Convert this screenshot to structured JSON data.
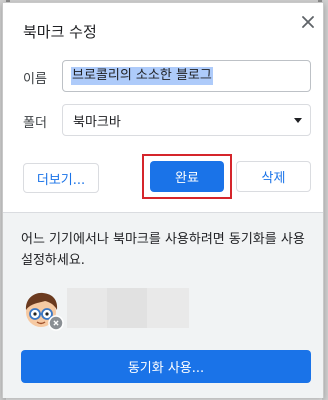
{
  "dialog": {
    "title": "북마크 수정",
    "close_icon": "close-icon"
  },
  "name_field": {
    "label": "이름",
    "value": "브로콜리의 소소한 블로그"
  },
  "folder_field": {
    "label": "폴더",
    "selected": "북마크바"
  },
  "buttons": {
    "more": "더보기...",
    "done": "완료",
    "delete": "삭제"
  },
  "sync": {
    "message": "어느 기기에서나 북마크를 사용하려면 동기화를 사용 설정하세요.",
    "button": "동기화 사용..."
  },
  "colors": {
    "accent": "#1a73e8",
    "highlight": "#d5252b"
  }
}
